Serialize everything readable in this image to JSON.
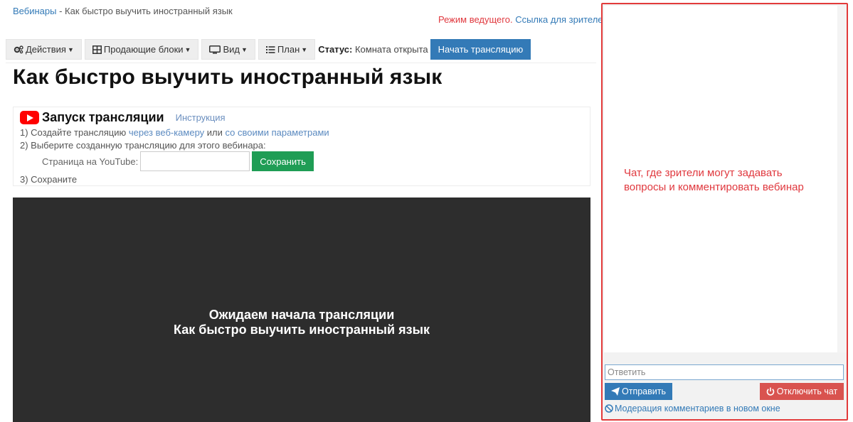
{
  "breadcrumb": {
    "link": "Вебинары",
    "separator": " - ",
    "current": "Как быстро выучить иностранный язык"
  },
  "host": {
    "mode": "Режим ведущего.",
    "viewer_link": "Ссылка для зрителей"
  },
  "toolbar": {
    "actions": "Действия",
    "selling_blocks": "Продающие блоки",
    "view": "Вид",
    "plan": "План",
    "status_label": "Статус:",
    "status_value": "Комната открыта",
    "start_broadcast": "Начать трансляцию"
  },
  "page_title": "Как быстро выучить иностранный язык",
  "launch": {
    "title": "Запуск трансляции",
    "instruction_link": "Инструкция",
    "step1_prefix": "1) Создайте трансляцию ",
    "step1_link1": "через веб-камеру",
    "step1_mid": " или ",
    "step1_link2": "со своими параметрами",
    "step2": "2) Выберите созданную трансляцию для этого вебинара:",
    "youtube_label": "Страница на YouTube:",
    "youtube_value": "",
    "save_button": "Сохранить",
    "step3": "3) Сохраните"
  },
  "video": {
    "line1": "Ожидаем начала трансляции",
    "line2": "Как быстро выучить иностранный язык"
  },
  "chat": {
    "note_line1": "Чат, где зрители могут задавать",
    "note_line2": "вопросы и комментировать вебинар",
    "reply_placeholder": "Ответить",
    "send_button": "Отправить",
    "disable_button": "Отключить чат",
    "moderation_link": "Модерация комментариев в новом окне"
  },
  "colors": {
    "primary": "#337ab7",
    "success": "#1f9d55",
    "danger": "#d9534f",
    "highlight_border": "#e23a3a",
    "video_bg": "#2d2d2d"
  }
}
